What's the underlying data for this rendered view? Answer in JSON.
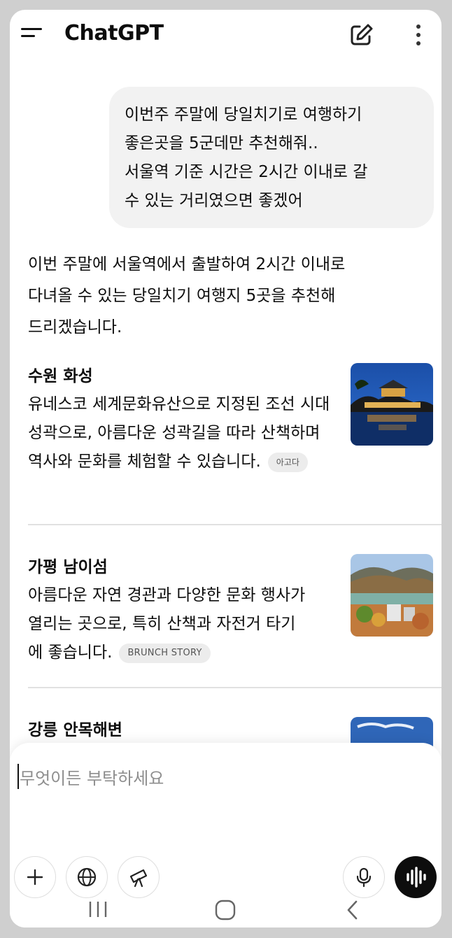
{
  "header": {
    "title": "ChatGPT",
    "icons": {
      "menu": "menu-icon",
      "edit": "edit-icon",
      "more": "more-vertical-icon"
    }
  },
  "user_message": "이번주 주말에 당일치기로 여행하기\n좋은곳을  5군데만 추천해줘..\n서울역 기준 시간은 2시간 이내로 갈\n수 있는 거리였으면 좋겠어",
  "assistant": {
    "intro": "이번 주말에 서울역에서 출발하여 2시간 이내로\n다녀올 수 있는 당일치기 여행지 5곳을 추천해\n드리겠습니다.",
    "places": [
      {
        "title": "수원 화성",
        "description": "유네스코 세계문화유산으로 지정된 조선 시대 성곽으로, 아름다운 성곽길을 따라 산책하며 역사와 문화를 체험할 수 있습니다.",
        "source": "아고다"
      },
      {
        "title": "가평 남이섬",
        "description": "아름다운 자연 경관과 다양한 문화 행사가 열리는 곳으로, 특히 산책과 자전거 타기에 좋습니다.",
        "source": "BRUNCH STORY"
      },
      {
        "title": "강릉 안목해변",
        "description": "",
        "source": ""
      }
    ]
  },
  "composer": {
    "placeholder": "무엇이든 부탁하세요",
    "value": "",
    "buttons": [
      "plus-icon",
      "globe-icon",
      "telescope-icon",
      "microphone-icon",
      "voice-mode-icon"
    ]
  },
  "colors": {
    "accent": "#0d0d0d",
    "bubble": "#f2f2f2",
    "chip": "#ececec"
  }
}
